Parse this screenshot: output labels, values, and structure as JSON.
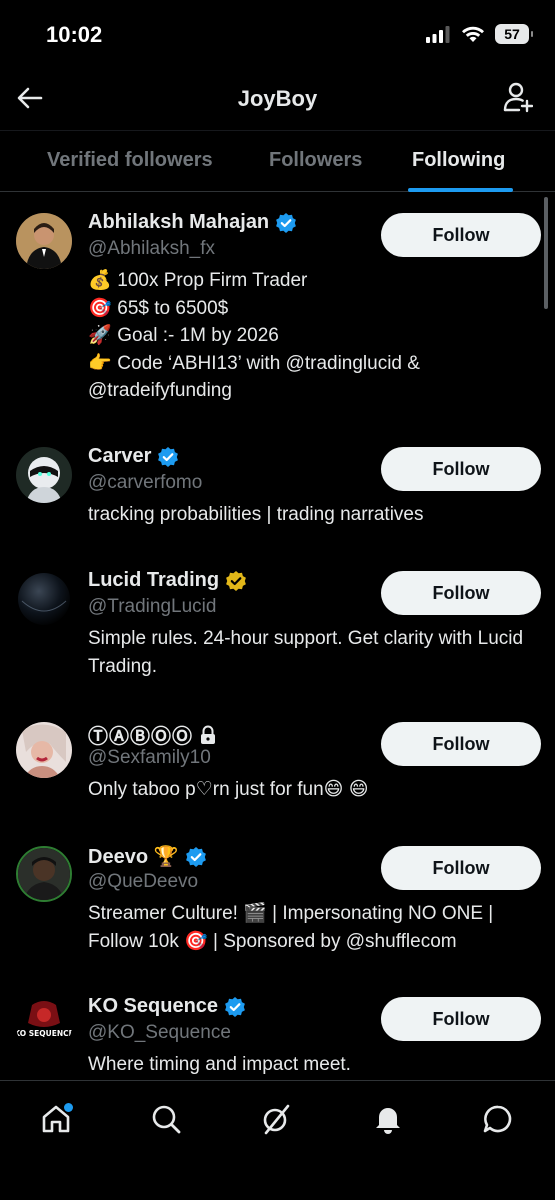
{
  "status": {
    "time": "10:02",
    "battery": "57"
  },
  "header": {
    "title": "JoyBoy"
  },
  "tabs": [
    {
      "label": "Verified followers"
    },
    {
      "label": "Followers"
    },
    {
      "label": "Following"
    }
  ],
  "accounts": [
    {
      "name": "Abhilaksh Mahajan",
      "badge": "blue",
      "handle": "@Abhilaksh_fx",
      "bio_lines": [
        {
          "emoji": "💰",
          "text": "100x Prop Firm Trader"
        },
        {
          "emoji": "🎯",
          "text": "65$ to 6500$"
        },
        {
          "emoji": "🚀",
          "text": "Goal :- 1M by 2026"
        },
        {
          "emoji": "👉",
          "text": "Code ‘ABHI13’ with @tradinglucid &"
        },
        {
          "emoji": "",
          "text": "@tradeifyfunding"
        }
      ],
      "button": "Follow"
    },
    {
      "name": "Carver",
      "badge": "blue",
      "handle": "@carverfomo",
      "bio": "tracking probabilities | trading narratives",
      "button": "Follow"
    },
    {
      "name": "Lucid Trading",
      "badge": "gold",
      "handle": "@TradingLucid",
      "bio": "Simple rules. 24-hour support. Get clarity with Lucid Trading.",
      "button": "Follow"
    },
    {
      "name": "ⓉⒶⒷⓄⓄ",
      "badge": "lock",
      "handle": "@Sexfamily10",
      "bio": "Only taboo p♡rn just for fun😄 😄",
      "button": "Follow"
    },
    {
      "name": "Deevo 🏆",
      "badge": "blue",
      "handle": "@QueDeevo",
      "bio": "Streamer Culture! 🎬 | Impersonating NO ONE | Follow 10k 🎯 | Sponsored by @shufflecom",
      "button": "Follow"
    },
    {
      "name": "KO Sequence",
      "badge": "blue",
      "handle": "@KO_Sequence",
      "bio": "Where timing and impact meet.",
      "button": "Follow",
      "avatar_text": "KO SEQUENCE"
    }
  ],
  "colors": {
    "accent": "#1d9bf0",
    "verified_blue": "#1d9bf0",
    "verified_gold": "#e2b719",
    "muted": "#71767b",
    "button_bg": "#eff3f4"
  },
  "nav": [
    "home-icon",
    "search-icon",
    "grok-icon",
    "notifications-icon",
    "messages-icon"
  ]
}
